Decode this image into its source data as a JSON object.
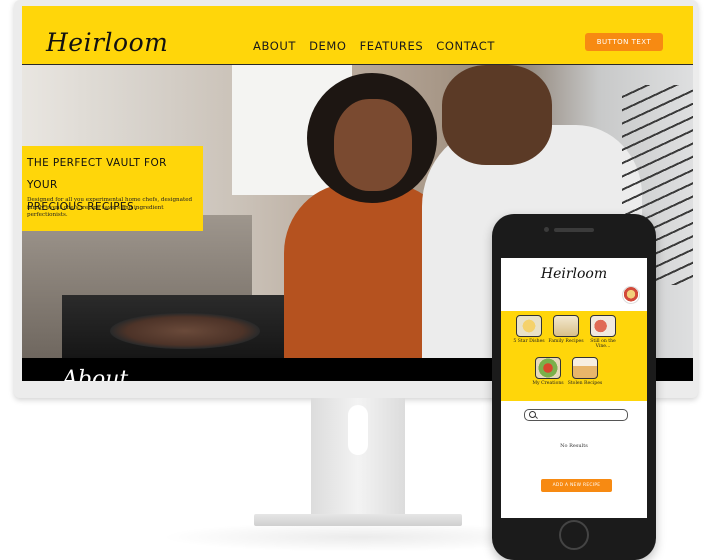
{
  "desktop": {
    "logo": "Heirloom",
    "nav": [
      "ABOUT",
      "DEMO",
      "FEATURES",
      "CONTACT"
    ],
    "cta_label": "BUTTON TEXT",
    "hero": {
      "title_line1": "THE PERFECT VAULT FOR YOUR",
      "title_line2": "PRECIOUS RECIPES.",
      "body": "Designed for all you experimental home chefs, designated family event chefs, recipe savers and ingredient perfectionists."
    },
    "about_heading": "About"
  },
  "mobile": {
    "logo": "Heirloom",
    "categories": [
      {
        "label": "5 Star Dishes",
        "icon": "dish-icon"
      },
      {
        "label": "Family Recipes",
        "icon": "cake-icon"
      },
      {
        "label": "Still on the Vine...",
        "icon": "fruit-icon"
      },
      {
        "label": "My Creations",
        "icon": "salad-icon"
      },
      {
        "label": "Stolen Recipes",
        "icon": "pie-icon"
      }
    ],
    "search_placeholder": "",
    "no_results": "No Results",
    "add_button": "ADD A NEW RECIPE"
  },
  "colors": {
    "brand_yellow": "#ffd60a",
    "accent_orange": "#f78a12"
  }
}
